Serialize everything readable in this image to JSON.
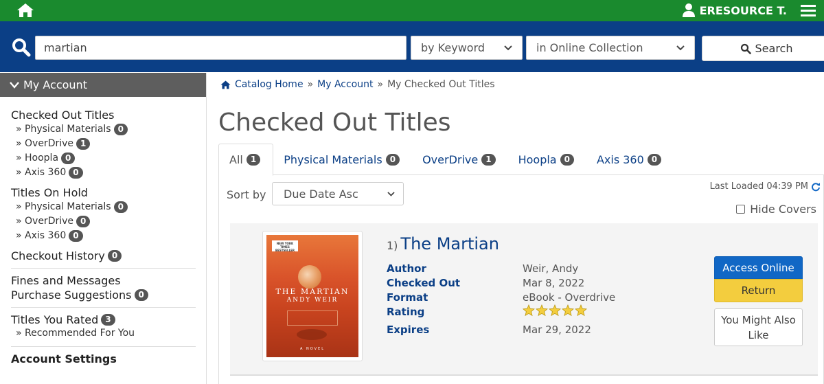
{
  "header": {
    "user_name": "ERESOURCE T."
  },
  "search": {
    "query": "martian",
    "search_by": "by Keyword",
    "collection": "in Online Collection",
    "button_label": "Search"
  },
  "sidebar": {
    "heading": "My Account",
    "checked_out": {
      "title": "Checked Out Titles",
      "items": [
        {
          "label": "» Physical Materials",
          "count": "0"
        },
        {
          "label": "» OverDrive",
          "count": "1"
        },
        {
          "label": "» Hoopla",
          "count": "0"
        },
        {
          "label": "» Axis 360",
          "count": "0"
        }
      ]
    },
    "on_hold": {
      "title": "Titles On Hold",
      "items": [
        {
          "label": "» Physical Materials",
          "count": "0"
        },
        {
          "label": "» OverDrive",
          "count": "0"
        },
        {
          "label": "» Axis 360",
          "count": "0"
        }
      ]
    },
    "checkout_history": {
      "label": "Checkout History",
      "count": "0"
    },
    "fines": {
      "label": "Fines and Messages"
    },
    "purchase_suggestions": {
      "label": "Purchase Suggestions",
      "count": "0"
    },
    "titles_rated": {
      "label": "Titles You Rated",
      "count": "3"
    },
    "recommended": {
      "label": "» Recommended For You"
    },
    "account_settings": {
      "label": "Account Settings"
    }
  },
  "breadcrumb": {
    "home": "Catalog Home",
    "sep1": "»",
    "my_account": "My Account",
    "sep2": "»",
    "current": "My Checked Out Titles"
  },
  "page": {
    "title": "Checked Out Titles"
  },
  "tabs": [
    {
      "label": "All",
      "count": "1"
    },
    {
      "label": "Physical Materials",
      "count": "0"
    },
    {
      "label": "OverDrive",
      "count": "1"
    },
    {
      "label": "Hoopla",
      "count": "0"
    },
    {
      "label": "Axis 360",
      "count": "0"
    }
  ],
  "sort": {
    "label": "Sort by",
    "selected": "Due Date Asc"
  },
  "last_loaded": "Last Loaded 04:39 PM",
  "hide_covers_label": "Hide Covers",
  "record": {
    "index": "1)",
    "title": "The Martian",
    "fields": [
      {
        "label": "Author",
        "value": "Weir, Andy"
      },
      {
        "label": "Checked Out",
        "value": "Mar 8, 2022"
      },
      {
        "label": "Format",
        "value": "eBook - Overdrive"
      },
      {
        "label": "Rating",
        "value": ""
      },
      {
        "label": "Expires",
        "value": "Mar 29, 2022"
      }
    ],
    "rating_stars": 5,
    "cover": {
      "banner": "NEW YORK TIMES BESTSELLER",
      "title": "THE MARTIAN",
      "author": "ANDY WEIR",
      "footer": "A NOVEL"
    },
    "actions": {
      "access": "Access Online",
      "return": "Return",
      "might_like": "You Might Also Like"
    }
  },
  "colors": {
    "top_bar": "#1a8a2e",
    "search_bar": "#0b3f86",
    "link": "#0b3f86",
    "access_button": "#1167c5",
    "return_button": "#f3cd3e",
    "badge": "#555555",
    "star": "#f3cd3e"
  }
}
